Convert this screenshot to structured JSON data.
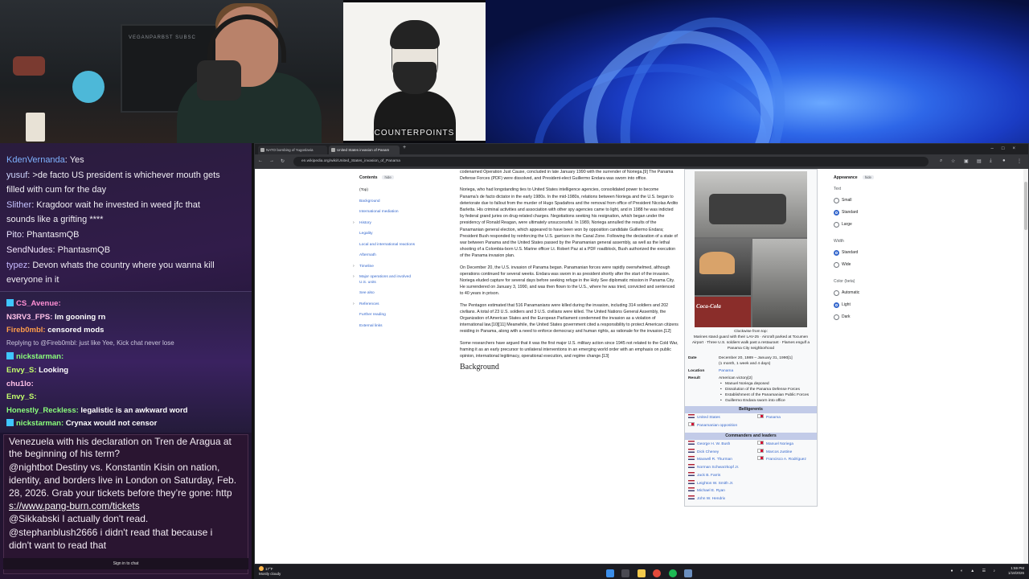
{
  "stream": {
    "cam2_label": "COUNTERPOINTS",
    "cam1_shelf_text": "VEGANPARBST SUBSC"
  },
  "chat_top": [
    {
      "user": "KdenVernanda",
      "msg": ": Yes"
    },
    {
      "user": "yusuf",
      "msg": ": >de facto US president is whichever mouth gets"
    },
    {
      "user": "",
      "msg": "filled with cum for the day"
    },
    {
      "user": "Slither",
      "msg": ": Kragdoor    wait he invested in weed jfc that"
    },
    {
      "user": "",
      "msg": "sounds like a grifting ****"
    },
    {
      "user": "Pito",
      "msg": ": PhantasmQB"
    },
    {
      "user": "SendNudes",
      "msg": ": PhantasmQB"
    },
    {
      "user": "typez",
      "msg": ": Devon whats the country where you wanna kill"
    },
    {
      "user": "",
      "msg": "everyone in it"
    }
  ],
  "chat_mid": [
    {
      "user": "CS_Avenue:",
      "msg": ""
    },
    {
      "user": "N3RV3_FPS:",
      "msg": " Im gooning rn"
    },
    {
      "user": "Fireb0mbl:",
      "msg": " censored mods"
    },
    {
      "user": "",
      "msg": "Replying to @Fireb0mbl: just like Yee, Kick chat never lose"
    },
    {
      "user": "nickstarman:",
      "msg": ""
    },
    {
      "user": "Envy_S:",
      "msg": " Looking"
    },
    {
      "user": "chu1lo:",
      "msg": ""
    },
    {
      "user": "Envy_S:",
      "msg": ""
    },
    {
      "user": "Honestly_Reckless:",
      "msg": " legalistic is an awkward word"
    },
    {
      "user": "nickstarman:",
      "msg": " Crynax would not censor"
    }
  ],
  "chat_bottom": {
    "lines": [
      "Venezuela with his declaration on Tren de Aragua at",
      "the beginning of his term?",
      "@nightbot Destiny vs. Konstantin Kisin on nation,",
      "identity, and borders live in London on Saturday, Feb.",
      "28, 2026. Grab your tickets before they’re gone: http",
      "s://www.pang-burn.com/tickets",
      "@Sikkabski I actually don't read.",
      "@stephanblush2666 i didn't read that because i",
      "didn't want to read that"
    ],
    "signin": "Sign in to chat"
  },
  "browser": {
    "tabs": [
      "NATO bombing of Yugoslavia",
      "United States invasion of Panam"
    ],
    "url": "en.wikipedia.org/wiki/United_States_invasion_of_Panama"
  },
  "toc": {
    "title": "Contents",
    "hide": "hide",
    "items": [
      {
        "label": "(Top)",
        "caret": false
      },
      {
        "label": "Background",
        "caret": false
      },
      {
        "label": "International mediation",
        "caret": false
      },
      {
        "label": "History",
        "caret": true
      },
      {
        "label": "Legality",
        "caret": false
      },
      {
        "label": "Local and international reactions",
        "caret": false
      },
      {
        "label": "Aftermath",
        "caret": false
      },
      {
        "label": "Timeline",
        "caret": true
      },
      {
        "label": "Major operations and involved",
        "caret": true
      },
      {
        "label": "U.S. units",
        "caret": false
      },
      {
        "label": "See also",
        "caret": false
      },
      {
        "label": "References",
        "caret": true
      },
      {
        "label": "Further reading",
        "caret": false
      },
      {
        "label": "External links",
        "caret": false
      }
    ]
  },
  "article": {
    "p1": "codenamed Operation Just Cause, concluded in late January 1990 with the surrender of Noriega.[9] The Panama Defense Forces (PDF) were dissolved, and President-elect Guillermo Endara was sworn into office.",
    "p2": "Noriega, who had longstanding ties to United States intelligence agencies, consolidated power to become Panama's de facto dictator in the early 1980s. In the mid-1980s, relations between Noriega and the U.S. began to deteriorate due to fallout from the murder of Hugo Spadafora and the removal from office of President Nicolas Ardito Barletta. His criminal activities and association with other spy agencies came to light, and in 1988 he was indicted by federal grand juries on drug-related charges. Negotiations seeking his resignation, which began under the presidency of Ronald Reagan, were ultimately unsuccessful. In 1989, Noriega annulled the results of the Panamanian general election, which appeared to have been won by opposition candidate Guillermo Endara; President Bush responded by reinforcing the U.S. garrison in the Canal Zone. Following the declaration of a state of war between Panama and the United States passed by the Panamanian general assembly, as well as the lethal shooting of a Colombia-born U.S. Marine officer Lt. Robert Paz at a PDF roadblock, Bush authorized the execution of the Panama invasion plan.",
    "p3": "On December 20, the U.S. invasion of Panama began. Panamanian forces were rapidly overwhelmed, although operations continued for several weeks. Endara was sworn in as president shortly after the start of the invasion. Noriega eluded capture for several days before seeking refuge in the Holy See diplomatic mission in Panama City. He surrendered on January 3, 1990, and was then flown to the U.S., where he was tried, convicted and sentenced to 40 years in prison.",
    "p4": "The Pentagon estimated that 516 Panamanians were killed during the invasion, including 314 soldiers and 202 civilians. A total of 23 U.S. soldiers and 3 U.S. civilians were killed. The United Nations General Assembly, the Organization of American States and the European Parliament condemned the invasion as a violation of international law.[10][11] Meanwhile, the United States government cited a responsibility to protect American citizens residing in Panama, along with a need to enforce democracy and human rights, as rationale for the invasion.[12]",
    "p5": "Some researchers have argued that it was the first major U.S. military action since 1945 not related to the Cold War, framing it as an early precursor to unilateral interventions in an emerging world order with an emphasis on public opinion, international legitimacy, operational execution, and regime change.[13]",
    "heading": "Background"
  },
  "infobox": {
    "caption_l1": "Clockwise from top:",
    "caption_l2": "Marines stand guard with their LAV-25 · Aircraft parked at Tocumen Airport · Three U.S. soldiers walk past a restaurant · Flames engulf a Panama City neighborhood",
    "date_label": "Date",
    "date_val": "December 20, 1989 – January 31, 1990[1]",
    "date_val2": "(1 month, 1 week and 4 days)",
    "location_label": "Location",
    "location_val": "Panama",
    "result_label": "Result",
    "result_val": "American victory[2]",
    "result_bullets": [
      "Manuel Noriega deposed",
      "Dissolution of the Panama Defense Forces",
      "Establishment of the Panamanian Public Forces",
      "Guillermo Endara sworn into office"
    ],
    "belligerents_title": "Belligerents",
    "bell_left": [
      "United States",
      "Panamanian opposition"
    ],
    "bell_right": [
      "Panama"
    ],
    "commanders_title": "Commanders and leaders",
    "cmd_left": [
      "George H. W. Bush",
      "Dick Cheney",
      "Maxwell R. Thurman",
      "Norman Schwarzkopf Jr.",
      "Jack B. Farris",
      "Leighton W. Smith Jr.",
      "Michael E. Ryan",
      "John W. Hendrix"
    ],
    "cmd_right": [
      "Manuel Noriega",
      "Marcos Justine",
      "Francisco A. Rodríguez"
    ]
  },
  "appearance": {
    "title": "Appearance",
    "hide": "hide",
    "text_label": "Text",
    "text_opts": [
      "Small",
      "Standard",
      "Large"
    ],
    "text_selected": 1,
    "width_label": "Width",
    "width_opts": [
      "Standard",
      "Wide"
    ],
    "width_selected": 0,
    "color_label": "Color (beta)",
    "color_opts": [
      "Automatic",
      "Light",
      "Dark"
    ],
    "color_selected": 1
  },
  "taskbar": {
    "weather_temp": "17°F",
    "weather_desc": "Mostly cloudy",
    "time": "1:59 PM",
    "date": "1/18/2026"
  }
}
